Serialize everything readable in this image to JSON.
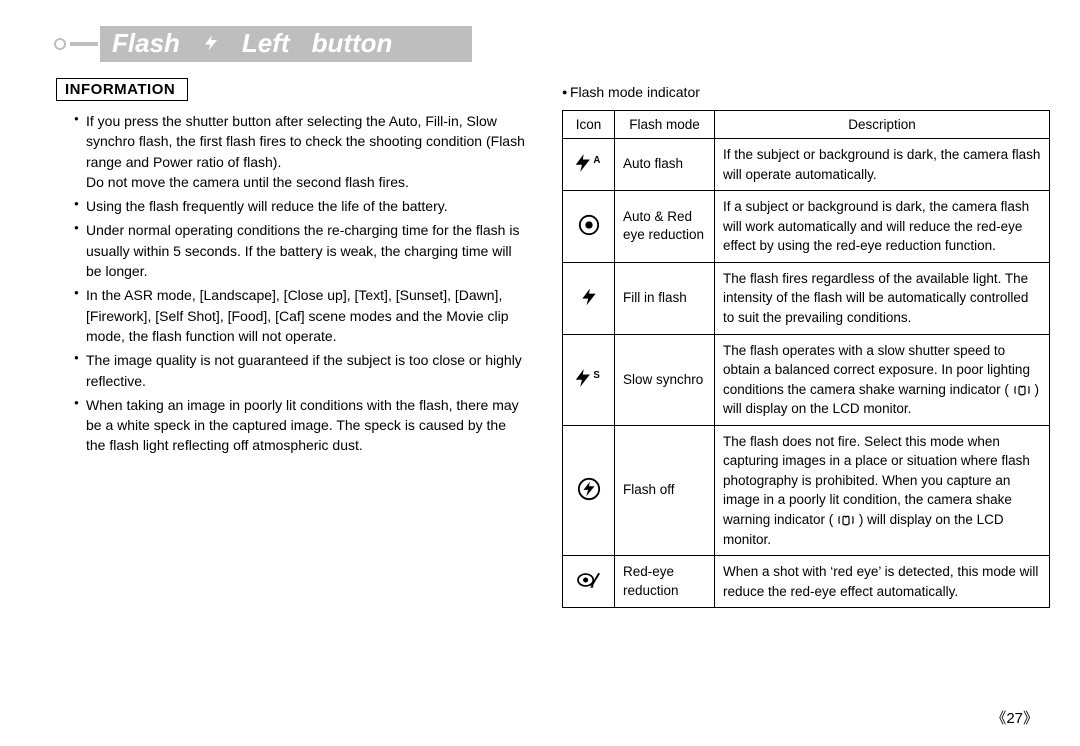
{
  "title": {
    "word1": "Flash",
    "gap1": "",
    "word2": "Left",
    "word3": "button"
  },
  "information": {
    "heading": "INFORMATION",
    "bullets": [
      {
        "text": "If you press the shutter button after selecting the Auto, Fill-in, Slow synchro flash, the first flash fires to check the shooting condition (Flash range and Power ratio of flash).",
        "sub": "Do not move the camera until the second flash fires."
      },
      {
        "text": "Using the flash frequently will reduce the life of the battery."
      },
      {
        "text": "Under normal operating conditions the re-charging time for the flash is usually within 5 seconds. If the battery is weak, the charging time will be longer."
      },
      {
        "text": "In the ASR mode, [Landscape], [Close up], [Text], [Sunset], [Dawn], [Firework], [Self Shot], [Food], [Caf] scene modes and the Movie clip mode, the flash function will not operate."
      },
      {
        "text": "The image quality is not guaranteed if the subject is too close or highly reflective."
      },
      {
        "text": "When taking an image in poorly lit conditions with the flash, there may be a white speck in the captured image. The speck is caused by the the flash light reflecting off atmospheric dust."
      }
    ]
  },
  "table": {
    "caption": "Flash mode indicator",
    "headers": {
      "icon": "Icon",
      "mode": "Flash mode",
      "desc": "Description"
    },
    "rows": [
      {
        "icon": "flash-auto",
        "mode": "Auto flash",
        "desc": "If the subject or background is dark, the camera flash will operate automatically."
      },
      {
        "icon": "eye",
        "mode": "Auto & Red eye reduction",
        "desc": "If a subject or background is dark, the camera flash will work automatically and will reduce the red-eye effect by using the red-eye reduction function."
      },
      {
        "icon": "flash",
        "mode": "Fill in flash",
        "desc": "The flash fires regardless of the available light. The intensity of the flash will be automatically controlled to suit the prevailing conditions."
      },
      {
        "icon": "flash-slow",
        "mode": "Slow synchro",
        "desc_pre": "The flash operates with a slow shutter speed to obtain a balanced correct exposure. In poor lighting conditions the camera shake warning indicator (",
        "desc_post": ") will display on the LCD monitor."
      },
      {
        "icon": "flash-off",
        "mode": "Flash off",
        "desc_pre": "The flash does not fire. Select this mode when capturing images in a place or situation where flash photography is prohibited. When you capture an image in a poorly lit condition, the camera shake warning indicator (",
        "desc_post": ") will display on the LCD monitor."
      },
      {
        "icon": "eye-brush",
        "mode": "Red-eye reduction",
        "desc": "When a shot with ‘red eye’ is detected, this mode will reduce the red-eye effect automatically."
      }
    ]
  },
  "page_number": "《27》"
}
